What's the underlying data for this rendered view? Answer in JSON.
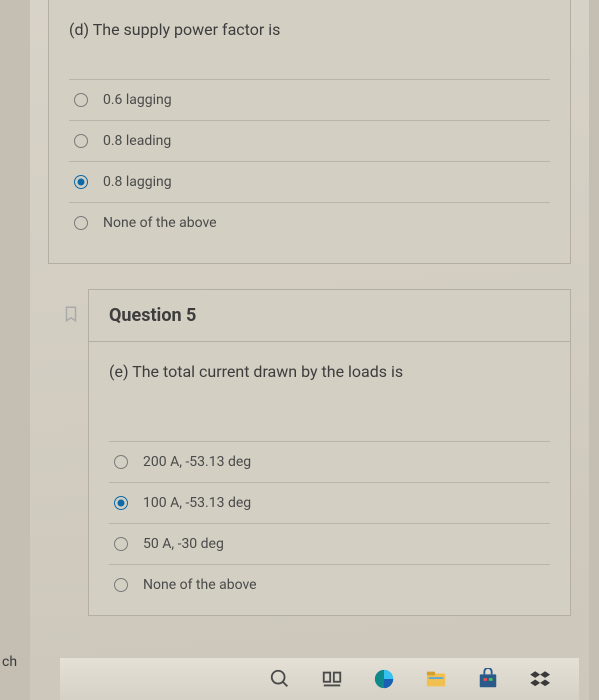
{
  "partial_question": {
    "prompt": "(d) The supply power factor is",
    "options": [
      {
        "label": "0.6 lagging",
        "selected": false
      },
      {
        "label": "0.8 leading",
        "selected": false
      },
      {
        "label": "0.8 lagging",
        "selected": true
      },
      {
        "label": "None of the above",
        "selected": false
      }
    ]
  },
  "question5": {
    "title": "Question 5",
    "prompt": "(e) The total current drawn by the loads is",
    "options": [
      {
        "label": "200 A, -53.13 deg",
        "selected": false
      },
      {
        "label": "100 A, -53.13 deg",
        "selected": true
      },
      {
        "label": "50 A, -30 deg",
        "selected": false
      },
      {
        "label": "None of the above",
        "selected": false
      }
    ]
  },
  "left_label": "ch",
  "taskbar": {
    "icons": [
      "search",
      "taskview",
      "edge",
      "explorer",
      "store",
      "dropbox"
    ]
  }
}
